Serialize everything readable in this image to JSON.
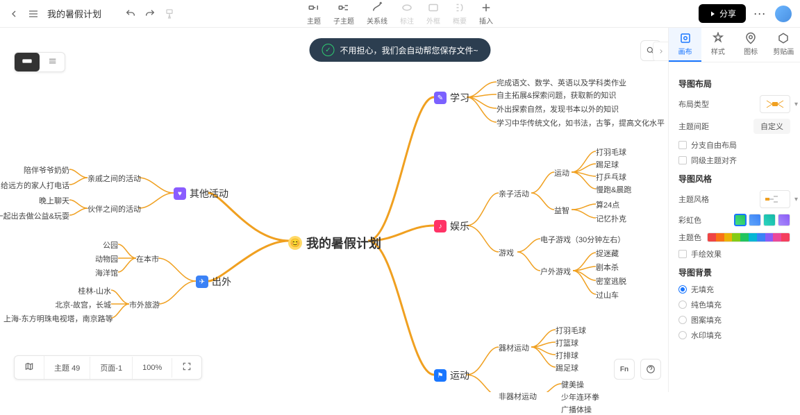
{
  "header": {
    "doc_title": "我的暑假计划",
    "toolbar": [
      {
        "label": "主题",
        "key": "topic"
      },
      {
        "label": "子主题",
        "key": "subtopic"
      },
      {
        "label": "关系线",
        "key": "relation"
      },
      {
        "label": "标注",
        "key": "marker",
        "disabled": true
      },
      {
        "label": "外框",
        "key": "frame",
        "disabled": true
      },
      {
        "label": "概要",
        "key": "summary",
        "disabled": true
      },
      {
        "label": "插入",
        "key": "insert"
      }
    ],
    "share": "分享"
  },
  "toast": "不用担心，我们会自动帮您保存文件~",
  "panel": {
    "tabs": [
      "画布",
      "样式",
      "图标",
      "剪贴画"
    ],
    "active_tab": 0,
    "sections": {
      "layout_title": "导图布局",
      "layout_type_label": "布局类型",
      "spacing_label": "主题间距",
      "spacing_value": "自定义",
      "free_layout": "分支自由布局",
      "same_level_align": "同级主题对齐",
      "style_title": "导图风格",
      "theme_style_label": "主题风格",
      "rainbow_label": "彩虹色",
      "theme_color_label": "主题色",
      "hand_drawn": "手绘效果",
      "bg_title": "导图背景",
      "bg_options": [
        "无填充",
        "纯色填充",
        "图案填充",
        "水印填充"
      ]
    }
  },
  "status": {
    "topics_label": "主题",
    "topics_count": 49,
    "page_label": "页面-1",
    "zoom": "100%"
  },
  "float": {
    "fn": "Fn"
  },
  "mindmap": {
    "root": "我的暑假计划",
    "branches": {
      "study": {
        "label": "学习",
        "leaves": [
          "完成语文、数学、英语以及学科类作业",
          "自主拓展&探索问题，获取新的知识",
          "外出探索自然，发现书本以外的知识",
          "学习中华传统文化，如书法，古筝，提高文化水平"
        ]
      },
      "entertainment": {
        "label": "娱乐",
        "children": {
          "parent_child": {
            "label": "亲子活动",
            "sub": {
              "sport": {
                "label": "运动",
                "leaves": [
                  "打羽毛球",
                  "踢足球",
                  "打乒乓球",
                  "慢跑&晨跑"
                ]
              },
              "puzzle": {
                "label": "益智",
                "leaves": [
                  "算24点",
                  "记忆扑克"
                ]
              }
            }
          },
          "games": {
            "label": "游戏",
            "leaves_direct": [
              "电子游戏（30分钟左右）"
            ],
            "sub": {
              "outdoor": {
                "label": "户外游戏",
                "leaves": [
                  "捉迷藏",
                  "剧本杀",
                  "密室逃脱",
                  "过山车"
                ]
              }
            }
          }
        }
      },
      "sports": {
        "label": "运动",
        "children": {
          "equipment": {
            "label": "器材运动",
            "leaves": [
              "打羽毛球",
              "打篮球",
              "打排球",
              "踢足球"
            ]
          },
          "no_equipment": {
            "label": "非器材运动",
            "leaves": [
              "健美操",
              "少年连环拳",
              "广播体操"
            ]
          }
        }
      },
      "other": {
        "label": "其他活动",
        "children": {
          "family": {
            "label": "亲戚之间的活动",
            "leaves": [
              "陪伴爷爷奶奶",
              "给远方的家人打电话"
            ]
          },
          "friends": {
            "label": "伙伴之间的活动",
            "leaves": [
              "晚上聊天",
              "一起出去做公益&玩耍"
            ]
          }
        }
      },
      "outing": {
        "label": "出外",
        "children": {
          "local": {
            "label": "在本市",
            "leaves": [
              "公园",
              "动物园",
              "海洋馆"
            ]
          },
          "travel": {
            "label": "市外旅游",
            "leaves": [
              "桂林-山水",
              "北京-故宫，长城",
              "上海-东方明珠电视塔，南京路等"
            ]
          }
        }
      }
    }
  }
}
